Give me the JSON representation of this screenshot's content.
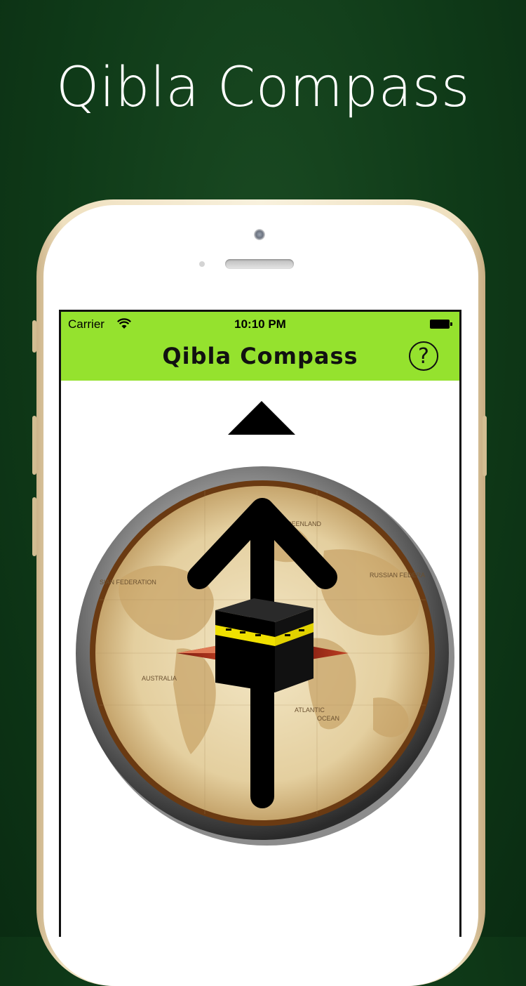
{
  "promo": {
    "title": "Qibla Compass"
  },
  "status_bar": {
    "carrier": "Carrier",
    "time": "10:10 PM"
  },
  "nav": {
    "title": "Qibla Compass",
    "help_label": "?"
  },
  "map_labels": {
    "russia_left": "SIAN FEDERATION",
    "russia_right": "RUSSIAN FEDERA",
    "greenland": "GREENLAND",
    "ocean_atlantic": "ATLANTIC",
    "ocean_label": "OCEAN",
    "australia": "AUSTRALIA"
  },
  "colors": {
    "background": "#0f3a18",
    "navbar": "#95e22e",
    "kaaba_band": "#f0e000",
    "arrow": "#000000"
  },
  "icons": [
    "wifi-icon",
    "battery-icon",
    "help-icon",
    "pointer-icon",
    "qibla-arrow-icon",
    "kaaba-icon"
  ]
}
